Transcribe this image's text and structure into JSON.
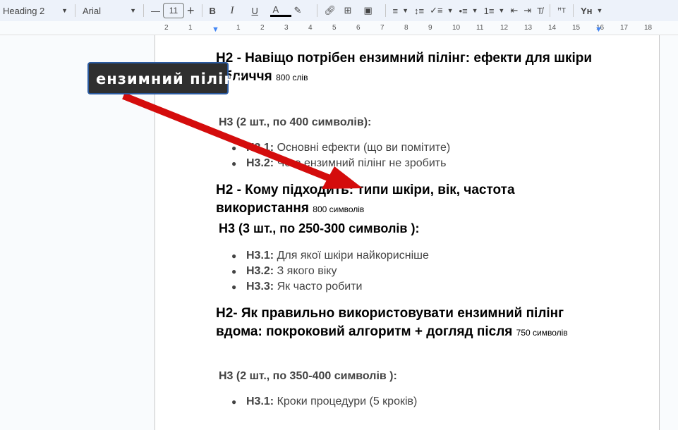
{
  "toolbar": {
    "style": "Heading 2",
    "font": "Arial",
    "font_size": "11",
    "icons": [
      "bold-icon",
      "italic-icon",
      "underline-icon",
      "text-color-icon",
      "highlight-icon",
      "link-icon",
      "comment-icon",
      "image-icon",
      "align-icon",
      "line-spacing-icon",
      "checklist-icon",
      "bullet-list-icon",
      "numbered-list-icon",
      "decrease-indent-icon",
      "increase-indent-icon",
      "clear-format-icon",
      "spellcheck-icon",
      "input-tools-icon"
    ]
  },
  "ruler": {
    "labels": [
      "2",
      "1",
      "1",
      "2",
      "3",
      "4",
      "5",
      "6",
      "7",
      "8",
      "9",
      "10",
      "11",
      "12",
      "13",
      "14",
      "15",
      "16",
      "17",
      "18"
    ]
  },
  "annotation": {
    "label": "ензимний пілінг",
    "arrow_color": "#d40c0c"
  },
  "doc": {
    "s1": {
      "h2": "H2 - Навіщо потрібен ензимний пілінг: ефекти для шкіри обличчя",
      "note": "800  слів",
      "h3": "H3 (2 шт., по 400 символів):",
      "items": [
        {
          "k": "H3.1:",
          "v": " Основні ефекти (що ви помітите)"
        },
        {
          "k": "H3.2:",
          "v": " Чого ензимний пілінг не зробить"
        }
      ]
    },
    "s2": {
      "h2": "H2 - Кому підходить: типи шкіри, вік, частота використання",
      "note": "800 символів",
      "h3": "H3 (3 шт., по 250-300 символів ):",
      "items": [
        {
          "k": "H3.1:",
          "v": " Для якої шкіри найкорисніше"
        },
        {
          "k": "H3.2:",
          "v": " З якого віку"
        },
        {
          "k": "H3.3:",
          "v": " Як часто робити"
        }
      ]
    },
    "s3": {
      "h2": "H2- Як правильно використовувати ензимний пілінг вдома: покроковий алгоритм + догляд після",
      "note": "750  символів",
      "h3": "H3 (2 шт., по 350-400 символів ):",
      "items": [
        {
          "k": "H3.1:",
          "v": " Кроки процедури (5 кроків)"
        }
      ]
    }
  }
}
